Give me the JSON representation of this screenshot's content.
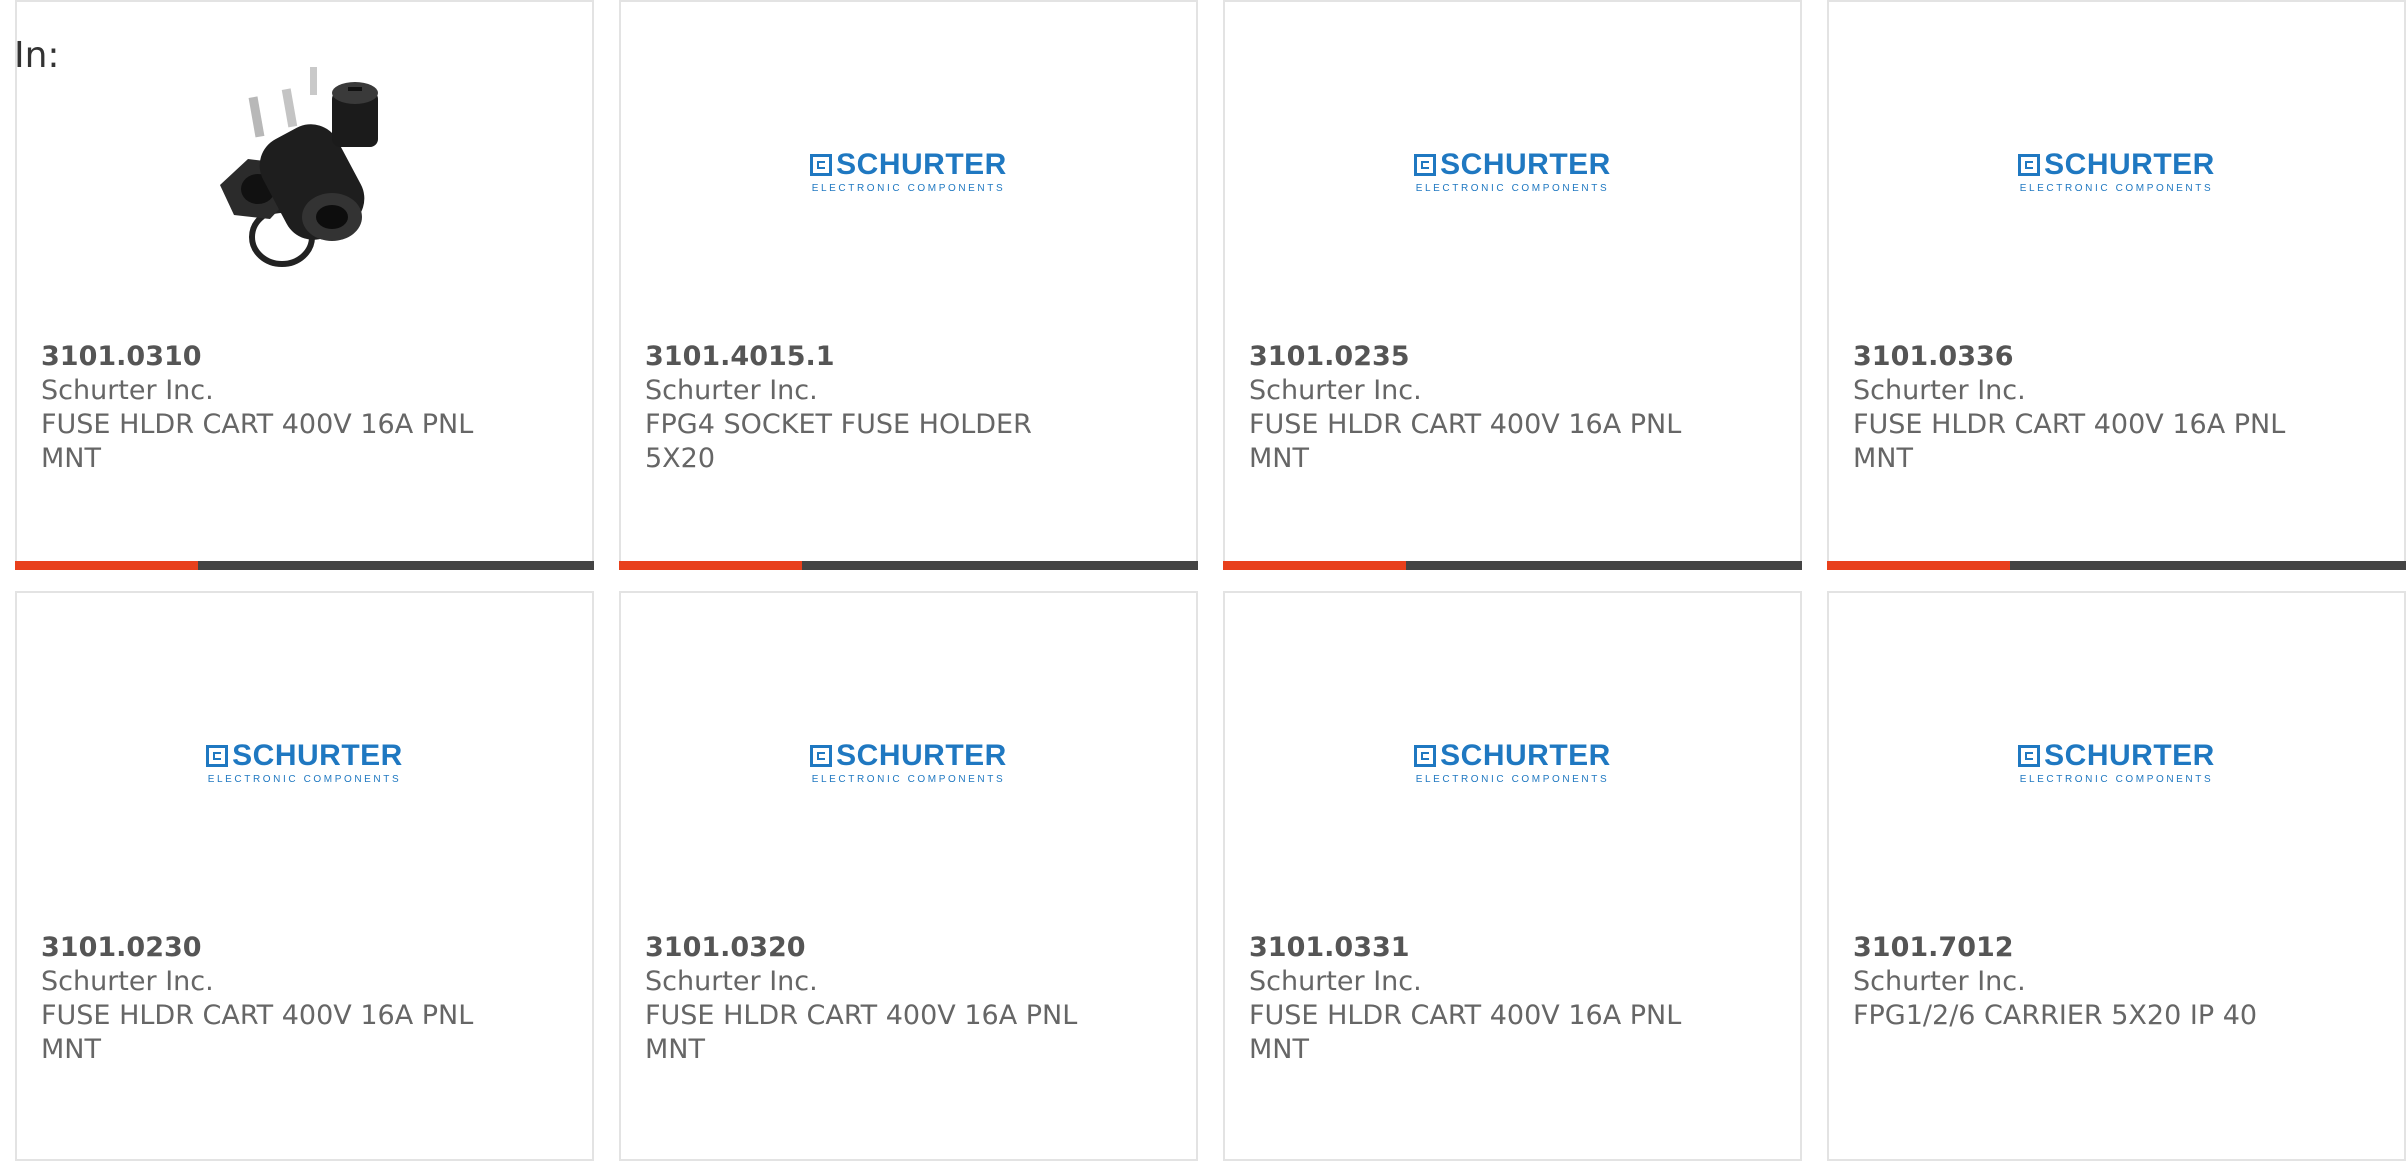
{
  "header": {
    "in_label": "In:"
  },
  "colors": {
    "accent": "#e8401c",
    "bar_dark": "#444444",
    "card_border": "#e3e3e3",
    "logo_blue": "#1f78c1"
  },
  "brand_logo": {
    "word": "SCHURTER",
    "subtitle": "ELECTRONIC COMPONENTS"
  },
  "products": [
    {
      "part_number": "3101.0310",
      "manufacturer": "Schurter Inc.",
      "description_line1": "FUSE HLDR CART 400V 16A PNL",
      "description_line2": "MNT",
      "image": "fuse-holder-photo",
      "has_bar": true
    },
    {
      "part_number": "3101.4015.1",
      "manufacturer": "Schurter Inc.",
      "description_line1": "FPG4 SOCKET FUSE HOLDER",
      "description_line2": "5X20",
      "image": "schurter-logo",
      "has_bar": true
    },
    {
      "part_number": "3101.0235",
      "manufacturer": "Schurter Inc.",
      "description_line1": "FUSE HLDR CART 400V 16A PNL",
      "description_line2": "MNT",
      "image": "schurter-logo",
      "has_bar": true
    },
    {
      "part_number": "3101.0336",
      "manufacturer": "Schurter Inc.",
      "description_line1": "FUSE HLDR CART 400V 16A PNL",
      "description_line2": "MNT",
      "image": "schurter-logo",
      "has_bar": true
    },
    {
      "part_number": "3101.0230",
      "manufacturer": "Schurter Inc.",
      "description_line1": "FUSE HLDR CART 400V 16A PNL",
      "description_line2": "MNT",
      "image": "schurter-logo",
      "has_bar": false
    },
    {
      "part_number": "3101.0320",
      "manufacturer": "Schurter Inc.",
      "description_line1": "FUSE HLDR CART 400V 16A PNL",
      "description_line2": "MNT",
      "image": "schurter-logo",
      "has_bar": false
    },
    {
      "part_number": "3101.0331",
      "manufacturer": "Schurter Inc.",
      "description_line1": "FUSE HLDR CART 400V 16A PNL",
      "description_line2": "MNT",
      "image": "schurter-logo",
      "has_bar": false
    },
    {
      "part_number": "3101.7012",
      "manufacturer": "Schurter Inc.",
      "description_line1": "FPG1/2/6 CARRIER 5X20 IP 40",
      "description_line2": "",
      "image": "schurter-logo",
      "has_bar": false
    }
  ]
}
